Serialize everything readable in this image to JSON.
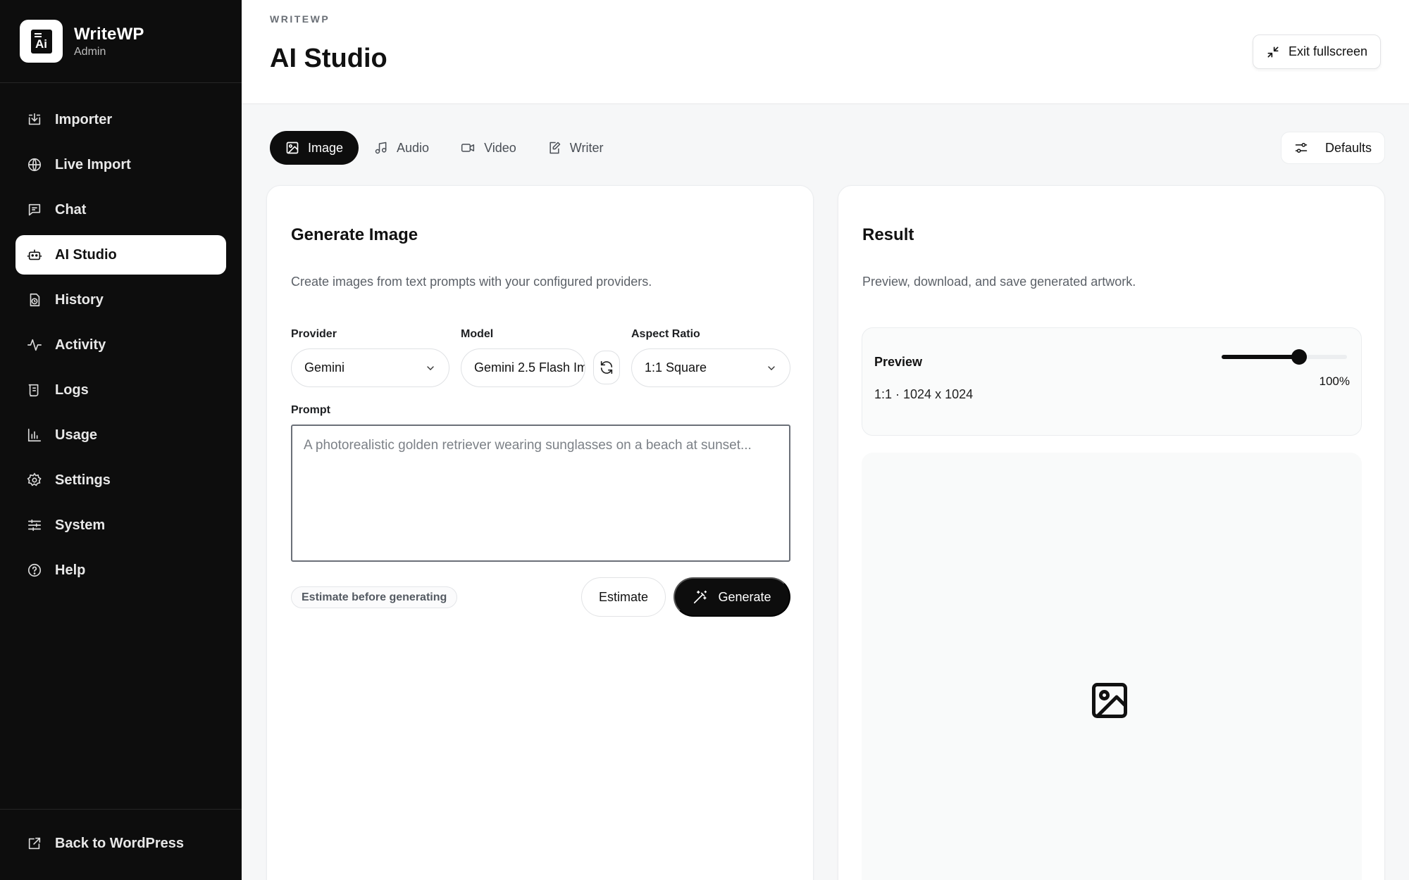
{
  "brand": {
    "title": "WriteWP",
    "subtitle": "Admin",
    "logo_text": "Ai"
  },
  "nav": {
    "items": [
      {
        "label": "Importer",
        "icon": "import-icon"
      },
      {
        "label": "Live Import",
        "icon": "globe-icon"
      },
      {
        "label": "Chat",
        "icon": "chat-icon"
      },
      {
        "label": "AI Studio",
        "icon": "robot-icon",
        "active": true
      },
      {
        "label": "History",
        "icon": "history-icon"
      },
      {
        "label": "Activity",
        "icon": "activity-icon"
      },
      {
        "label": "Logs",
        "icon": "logs-icon"
      },
      {
        "label": "Usage",
        "icon": "bar-chart-icon"
      },
      {
        "label": "Settings",
        "icon": "gear-icon"
      },
      {
        "label": "System",
        "icon": "sliders-icon"
      },
      {
        "label": "Help",
        "icon": "help-icon"
      }
    ],
    "footer": {
      "label": "Back to WordPress",
      "icon": "external-link-icon"
    }
  },
  "header": {
    "eyebrow": "WRITEWP",
    "title": "AI Studio",
    "exit_label": "Exit fullscreen"
  },
  "tabs": [
    {
      "label": "Image",
      "icon": "image-icon",
      "active": true
    },
    {
      "label": "Audio",
      "icon": "music-icon"
    },
    {
      "label": "Video",
      "icon": "video-icon"
    },
    {
      "label": "Writer",
      "icon": "edit-icon"
    }
  ],
  "defaults_label": "Defaults",
  "generate_panel": {
    "title": "Generate Image",
    "description": "Create images from text prompts with your configured providers.",
    "provider": {
      "label": "Provider",
      "value": "Gemini"
    },
    "model": {
      "label": "Model",
      "value": "Gemini 2.5 Flash Im"
    },
    "aspect": {
      "label": "Aspect Ratio",
      "value": "1:1 Square"
    },
    "prompt": {
      "label": "Prompt",
      "value": "",
      "placeholder": "A photorealistic golden retriever wearing sunglasses on a beach at sunset..."
    },
    "estimate_hint": "Estimate before generating",
    "estimate_label": "Estimate",
    "generate_label": "Generate"
  },
  "result_panel": {
    "title": "Result",
    "description": "Preview, download, and save generated artwork.",
    "preview_label": "Preview",
    "preview_meta": "1:1 · 1024 x 1024",
    "zoom": "100%",
    "zoom_fraction": 0.62
  },
  "colors": {
    "sidebar_bg": "#0d0d0d",
    "accent": "#0d0d0d",
    "page_bg": "#f6f7f8"
  }
}
